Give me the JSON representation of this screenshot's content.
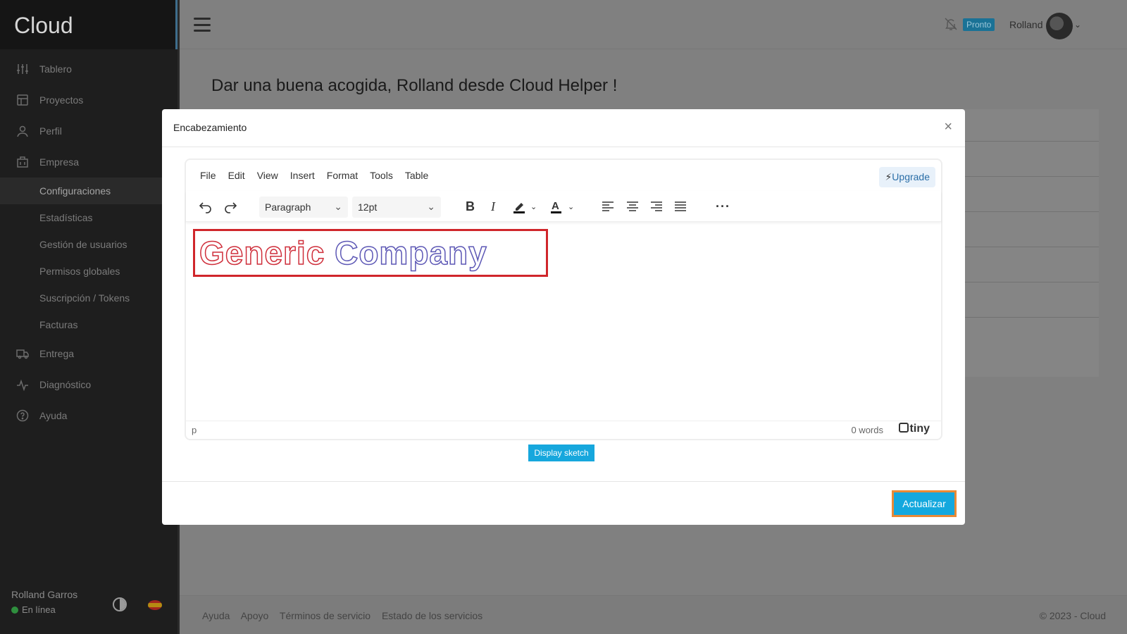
{
  "app": {
    "brand": "Cloud"
  },
  "sidebar": {
    "items": [
      {
        "label": "Tablero",
        "icon": "sliders-icon"
      },
      {
        "label": "Proyectos",
        "icon": "layout-icon"
      },
      {
        "label": "Perfil",
        "icon": "user-icon"
      },
      {
        "label": "Empresa",
        "icon": "building-icon"
      }
    ],
    "subitems": [
      {
        "label": "Configuraciones",
        "active": true
      },
      {
        "label": "Estadísticas"
      },
      {
        "label": "Gestión de usuarios"
      },
      {
        "label": "Permisos globales"
      },
      {
        "label": "Suscripción / Tokens"
      },
      {
        "label": "Facturas"
      }
    ],
    "items2": [
      {
        "label": "Entrega",
        "icon": "truck-icon"
      },
      {
        "label": "Diagnóstico",
        "icon": "activity-icon"
      },
      {
        "label": "Ayuda",
        "icon": "help-icon"
      }
    ],
    "footer": {
      "user": "Rolland Garros",
      "status": "En línea"
    }
  },
  "topbar": {
    "badge": "Pronto",
    "user": "Rolland"
  },
  "page": {
    "title": "Dar una buena acogida, Rolland desde Cloud Helper !"
  },
  "modal": {
    "title": "Encabezamiento",
    "editor": {
      "menu": [
        "File",
        "Edit",
        "View",
        "Insert",
        "Format",
        "Tools",
        "Table"
      ],
      "upgrade": "Upgrade",
      "block_format": "Paragraph",
      "font_size": "12pt",
      "content_logo": {
        "part1": "Generic",
        "part2": "Company"
      },
      "status_path": "p",
      "word_count": "0 words",
      "brand": "tiny"
    },
    "sketch_button": "Display sketch",
    "submit_button": "Actualizar"
  },
  "footer": {
    "links": [
      "Ayuda",
      "Apoyo",
      "Términos de servicio",
      "Estado de los servicios"
    ],
    "copyright": "© 2023 - Cloud"
  }
}
